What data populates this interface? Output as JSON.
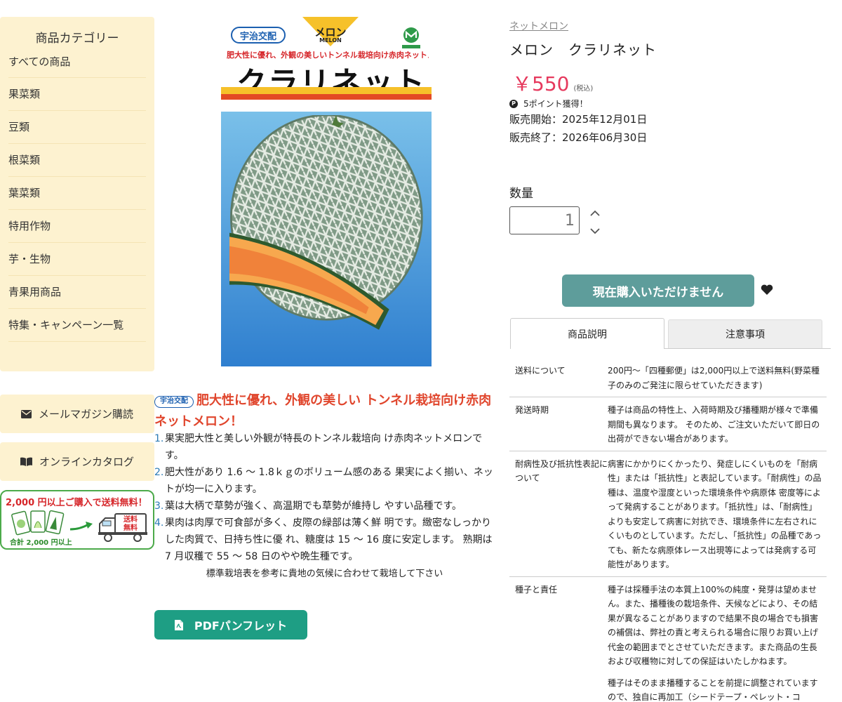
{
  "sidebar": {
    "title": "商品カテゴリー",
    "categories": [
      "すべての商品",
      "果菜類",
      "豆類",
      "根菜類",
      "葉菜類",
      "特用作物",
      "芋・生物",
      "青果用商品",
      "特集・キャンペーン一覧"
    ],
    "mail_magazine_label": "メールマガジン購読",
    "online_catalog_label": "オンラインカタログ",
    "shipping_banner": {
      "headline": "2,000 円以上ご購入で送料無料！",
      "subline": "合計 2,000 円以上",
      "truck_text": "送料無料"
    }
  },
  "product_image": {
    "brand_badge": "宇治交配",
    "type_jp": "メロン",
    "type_en": "MELON",
    "copy": "肥大性に優れ、外観の美しいトンネル栽培向け赤肉ネットメロン！",
    "name": "クラリネット",
    "logo_text": "MARUTANE"
  },
  "description": {
    "badge": "宇治交配",
    "heading": "肥大性に優れ、外観の美しい トンネル栽培向け赤肉ネットメロン！",
    "features": [
      {
        "num": "1.",
        "text": "果実肥大性と美しい外観が特長のトンネル栽培向 け赤肉ネットメロンです。"
      },
      {
        "num": "2.",
        "text": "肥大性があり 1.6 〜 1.8ｋｇのボリューム感のある 果実によく揃い、ネットが均一に入ります。"
      },
      {
        "num": "3.",
        "text": "葉は大柄で草勢が強く、高温期でも草勢が維持し やすい品種です。"
      },
      {
        "num": "4.",
        "text": "果肉は肉厚で可食部が多く、皮際の緑部は薄く鮮 明です。緻密なしっかりした肉質で、日持ち性に優 れ、糖度は 15 〜 16 度に安定します。 熟期は 7 月収穫で 55 〜 58 日のやや晩生種です。"
      }
    ],
    "note": "標準栽培表を参考に貴地の気候に合わせて栽培して下さい",
    "pdf_button_label": "PDFパンフレット"
  },
  "product": {
    "breadcrumb": "ネットメロン",
    "title": "メロン　クラリネット",
    "price": "￥550",
    "tax_note": "(税込)",
    "points": "5ポイント獲得！",
    "sale_start": "販売開始：2025年12月01日",
    "sale_end": "販売終了：2026年06月30日",
    "quantity_label": "数量",
    "quantity_value": "1",
    "purchase_button_label": "現在購入いただけません"
  },
  "tabs": {
    "description": "商品説明",
    "notice": "注意事項"
  },
  "info_table": [
    {
      "label": "送料について",
      "value": [
        "200円〜「四種郵便」は2,000円以上で送料無料(野菜種子のみのご発注に限らせていただきます)"
      ]
    },
    {
      "label": "発送時期",
      "value": [
        "種子は商品の特性上、入荷時期及び播種期が様々で準備期間も異なります。 そのため、ご注文いただいて即日の出荷ができない場合があります。"
      ]
    },
    {
      "label": "耐病性及び抵抗性表記について",
      "value": [
        "病害にかかりにくかったり、発症しにくいものを「耐病性」または「抵抗性」と表記しています。「耐病性」の品種は、温度や湿度といった環境条件や病原体 密度等によって発病することがあります。「抵抗性」は、「耐病性」よりも安定して病害に対抗でき、環境条件に左右されにくいものとしています。ただし、「抵抗性」の品種であっても、新たな病原体レース出現等によっては発病する可能性があります。"
      ]
    },
    {
      "label": "種子と責任",
      "value": [
        "種子は採種手法の本質上100%の純度・発芽は望めません。また、播種後の栽培条件、天候などにより、その結果が異なることがありますので結果不良の場合でも損害の補償は、弊社の責と考えられる場合に限りお買い上げ代金の範囲までとさせていただきます。また商品の生長および収穫物に対しての保証はいたしかねます。",
        "種子はそのまま播種することを前提に調整されていますので、独自に再加工（シードテープ・ペレット・コ"
      ]
    }
  ],
  "colors": {
    "sidebar_bg": "#fdf2d0",
    "price": "#e6395d",
    "heading_red": "#e0452c",
    "list_number": "#2a7ab5",
    "pdf_button": "#1e9e84",
    "purchase_button": "#5e9d9b"
  },
  "icons": {
    "mail": "envelope-icon",
    "catalog": "book-icon",
    "pdf": "pdf-file-icon",
    "points": "point-icon",
    "qty_up": "chevron-up-icon",
    "qty_down": "chevron-down-icon",
    "favorite": "heart-icon"
  }
}
